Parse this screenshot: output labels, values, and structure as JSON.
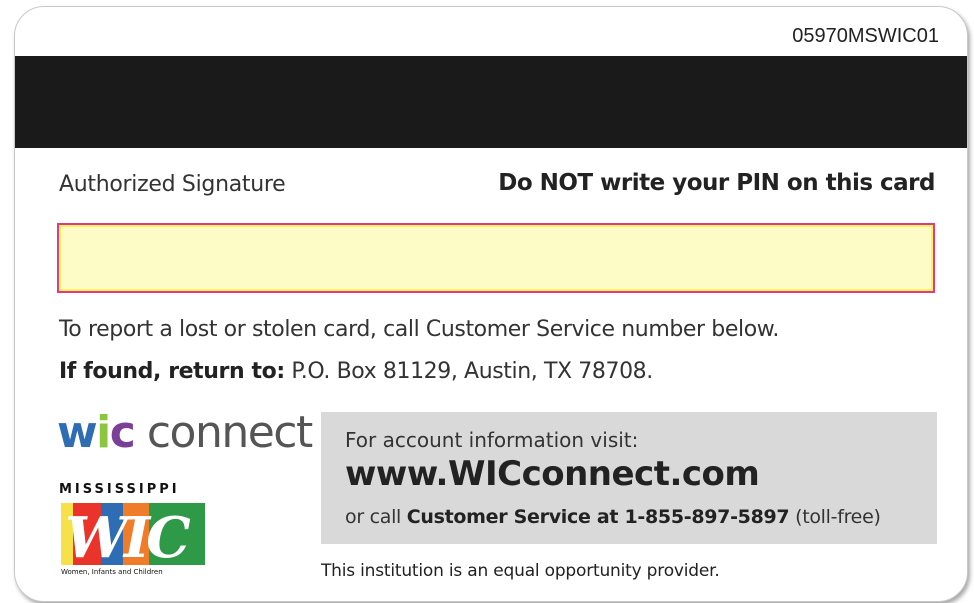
{
  "card": {
    "number": "05970MSWIC01",
    "signature_label": "Authorized Signature",
    "pin_warning": "Do NOT write your PIN on this card"
  },
  "notices": {
    "lost_card": "To report a lost or stolen card, call Customer Service number below.",
    "found_label": "If found, return to:",
    "found_address": " P.O. Box 81129, Austin, TX 78708."
  },
  "brand": {
    "wic_w": "w",
    "wic_i": "i",
    "wic_c": "c",
    "connect": " connect",
    "state": "MISSISSIPPI",
    "program": "WIC",
    "program_full": "Women, Infants and Children"
  },
  "info_box": {
    "visit_text": "For account information visit:",
    "url": "www.WICconnect.com",
    "call_prefix": "or call ",
    "call_bold": "Customer Service at 1-855-897-5897",
    "call_suffix": " (toll-free)"
  },
  "footer": {
    "equal_opportunity": "This institution is an equal opportunity provider."
  },
  "colors": {
    "stripe": "#1a1a1a",
    "signature_panel": "#fefcc6",
    "signature_border": "#e2388b",
    "wic_blue": "#2e6db4",
    "wic_green": "#8cc63f",
    "wic_purple": "#7b3f98",
    "info_box": "#d9d9d9"
  }
}
